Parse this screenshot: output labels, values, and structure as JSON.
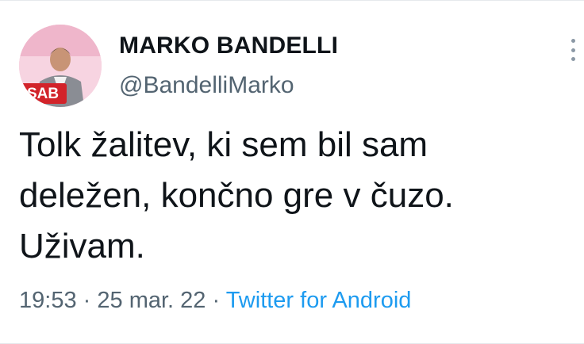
{
  "tweet": {
    "author": {
      "display_name": "MARKO BANDELLI",
      "handle": "@BandelliMarko",
      "avatar_badge_text": "SAB",
      "avatar_icon": "user-avatar"
    },
    "text_lines": [
      "Tolk žalitev, ki sem bil sam",
      "deležen, končno gre v čuzo.",
      "Uživam."
    ],
    "time": "19:53",
    "date": "25 mar. 22",
    "separator": "·",
    "source": "Twitter for Android",
    "more_icon": "more-vertical-icon"
  },
  "colors": {
    "text": "#0f1419",
    "secondary": "#536471",
    "link": "#1d9bf0",
    "avatar_bg": "#f4c6d6",
    "badge": "#d2232a"
  }
}
